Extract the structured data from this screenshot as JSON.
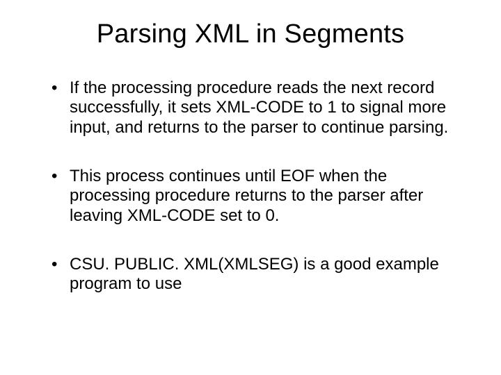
{
  "title": "Parsing XML in Segments",
  "bullets": [
    "If the processing procedure reads the next record successfully, it sets XML-CODE to 1 to signal more input, and returns to the parser to continue parsing.",
    "This process continues until EOF when the processing procedure returns to the parser after leaving XML-CODE set to 0.",
    "CSU. PUBLIC. XML(XMLSEG) is a good example program to use"
  ]
}
